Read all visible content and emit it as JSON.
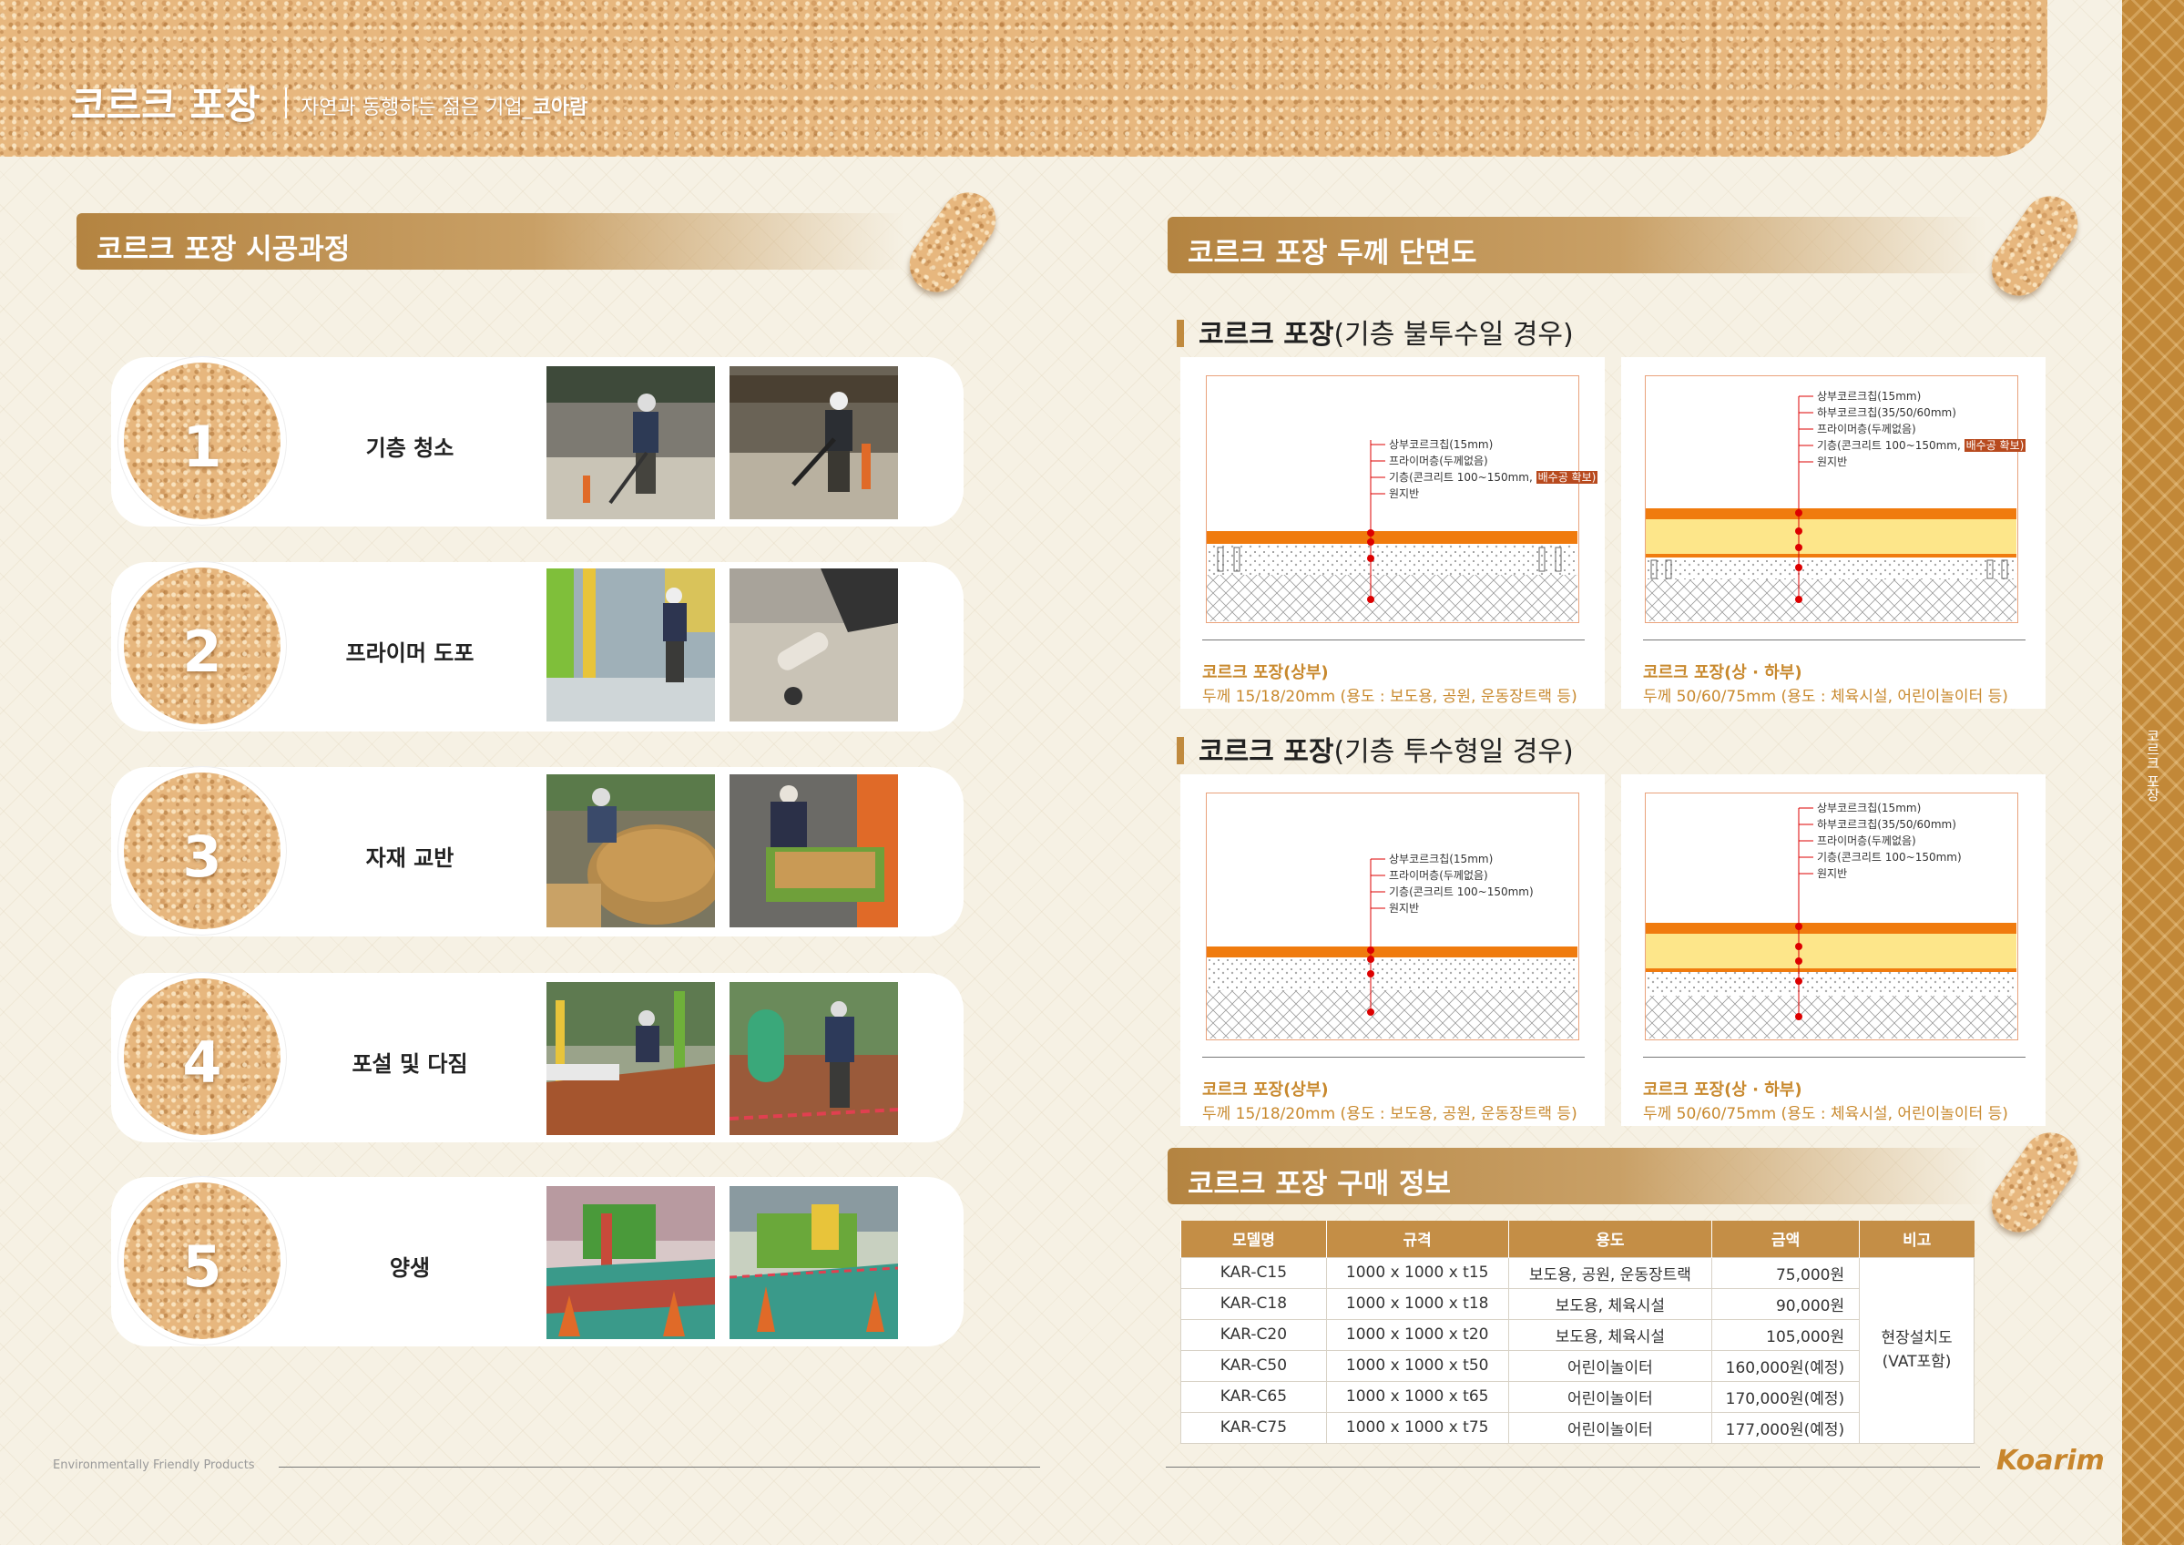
{
  "header": {
    "title": "코르크 포장",
    "subtitle": "자연과 동행하는 젊은 기업_",
    "subtitle_brand": "코아람"
  },
  "side_label": "코르크 포장",
  "process": {
    "heading": "코르크 포장 시공과정",
    "steps": [
      {
        "number": "1",
        "label": "기층 청소"
      },
      {
        "number": "2",
        "label": "프라이머 도포"
      },
      {
        "number": "3",
        "label": "자재 교반"
      },
      {
        "number": "4",
        "label": "포설 및 다짐"
      },
      {
        "number": "5",
        "label": "양생"
      }
    ]
  },
  "sections": {
    "heading": "코르크 포장 두께 단면도",
    "impermeable": {
      "title": "코르크 포장",
      "title_suffix": "(기층 불투수일 경우)",
      "left": {
        "labels": [
          "상부코르크칩(15mm)",
          "프라이머층(두께없음)",
          "기층(콘크리트 100~150mm, ",
          "원지반"
        ],
        "highlight": "배수공 확보)",
        "name": "코르크 포장(상부)",
        "desc": "두께 15/18/20mm (용도 : 보도용, 공원, 운동장트랙 등)"
      },
      "right": {
        "labels": [
          "상부코르크칩(15mm)",
          "하부코르크칩(35/50/60mm)",
          "프라이머층(두께없음)",
          "기층(콘크리트 100~150mm, ",
          "원지반"
        ],
        "highlight": "배수공 확보)",
        "name": "코르크 포장(상 · 하부)",
        "desc": "두께 50/60/75mm (용도 : 체육시설, 어린이놀이터 등)"
      }
    },
    "permeable": {
      "title": "코르크 포장",
      "title_suffix": "(기층 투수형일 경우)",
      "left": {
        "labels": [
          "상부코르크칩(15mm)",
          "프라이머층(두께없음)",
          "기층(콘크리트 100~150mm)",
          "원지반"
        ],
        "name": "코르크 포장(상부)",
        "desc": "두께 15/18/20mm (용도 : 보도용, 공원, 운동장트랙 등)"
      },
      "right": {
        "labels": [
          "상부코르크칩(15mm)",
          "하부코르크칩(35/50/60mm)",
          "프라이머층(두께없음)",
          "기층(콘크리트 100~150mm)",
          "원지반"
        ],
        "name": "코르크 포장(상 · 하부)",
        "desc": "두께 50/60/75mm (용도 : 체육시설, 어린이놀이터 등)"
      }
    }
  },
  "purchase": {
    "heading": "코르크 포장 구매 정보",
    "columns": [
      "모델명",
      "규격",
      "용도",
      "금액",
      "비고"
    ],
    "rows": [
      [
        "KAR-C15",
        "1000 x 1000 x t15",
        "보도용, 공원, 운동장트랙",
        "75,000원"
      ],
      [
        "KAR-C18",
        "1000 x 1000 x t18",
        "보도용, 체육시설",
        "90,000원"
      ],
      [
        "KAR-C20",
        "1000 x 1000 x t20",
        "보도용, 체육시설",
        "105,000원"
      ],
      [
        "KAR-C50",
        "1000 x 1000 x t50",
        "어린이놀이터",
        "160,000원(예정)"
      ],
      [
        "KAR-C65",
        "1000 x 1000 x t65",
        "어린이놀이터",
        "170,000원(예정)"
      ],
      [
        "KAR-C75",
        "1000 x 1000 x t75",
        "어린이놀이터",
        "177,000원(예정)"
      ]
    ],
    "note_line1": "현장설치도",
    "note_line2": "(VAT포함)"
  },
  "footer": {
    "left_text": "Environmentally Friendly Products",
    "logo": "Koarim"
  }
}
